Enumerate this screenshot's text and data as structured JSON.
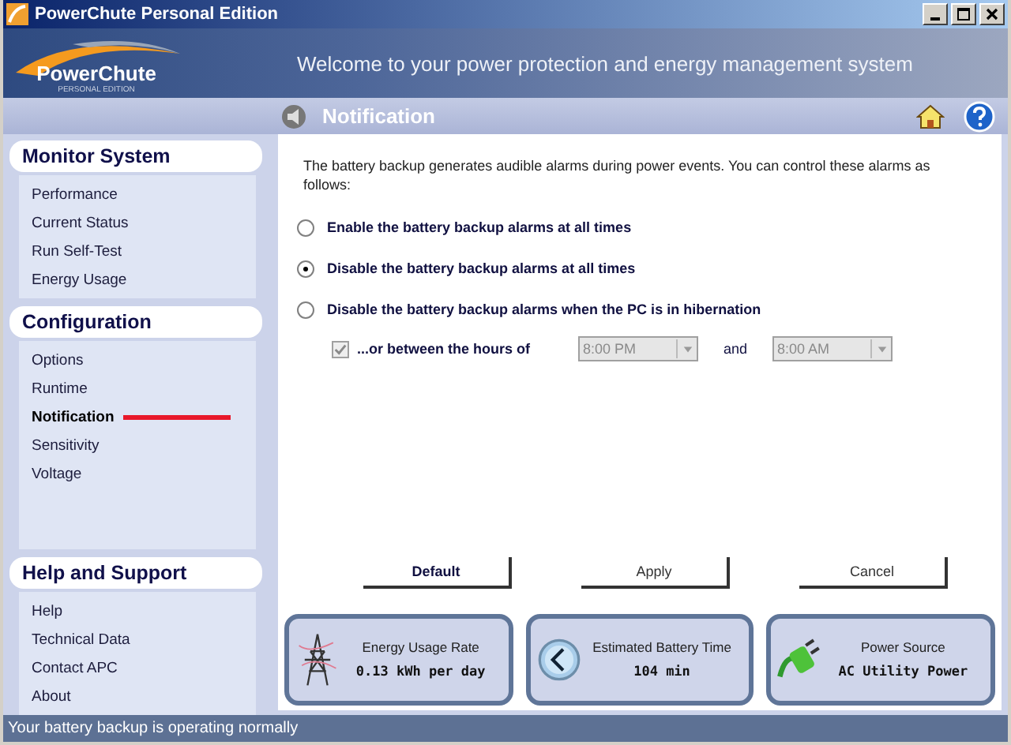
{
  "window": {
    "title": "PowerChute Personal Edition"
  },
  "banner": {
    "logo_name": "PowerChute",
    "logo_sub": "PERSONAL EDITION",
    "welcome": "Welcome to your power protection and energy management system"
  },
  "header": {
    "title": "Notification"
  },
  "sidebar": {
    "sections": [
      {
        "title": "Monitor System",
        "items": [
          {
            "label": "Performance",
            "selected": false
          },
          {
            "label": "Current Status",
            "selected": false
          },
          {
            "label": "Run Self-Test",
            "selected": false
          },
          {
            "label": "Energy Usage",
            "selected": false
          }
        ]
      },
      {
        "title": "Configuration",
        "items": [
          {
            "label": "Options",
            "selected": false
          },
          {
            "label": "Runtime",
            "selected": false
          },
          {
            "label": "Notification",
            "selected": true
          },
          {
            "label": "Sensitivity",
            "selected": false
          },
          {
            "label": "Voltage",
            "selected": false
          }
        ]
      },
      {
        "title": "Help and Support",
        "items": [
          {
            "label": "Help",
            "selected": false
          },
          {
            "label": "Technical Data",
            "selected": false
          },
          {
            "label": "Contact APC",
            "selected": false
          },
          {
            "label": "About",
            "selected": false
          }
        ]
      }
    ]
  },
  "content": {
    "intro": "The battery backup generates audible alarms during power events. You can control these alarms as follows:",
    "options": [
      {
        "label": "Enable the battery backup alarms at all times",
        "selected": false
      },
      {
        "label": "Disable the battery backup alarms at all times",
        "selected": true
      },
      {
        "label": "Disable the battery backup alarms when the PC is in hibernation",
        "selected": false
      }
    ],
    "schedule": {
      "label": "...or between the hours of",
      "checked": true,
      "disabled": true,
      "from": "8:00 PM",
      "and_label": "and",
      "to": "8:00 AM"
    },
    "buttons": [
      {
        "label": "Default",
        "default": true
      },
      {
        "label": "Apply",
        "default": false
      },
      {
        "label": "Cancel",
        "default": false
      }
    ]
  },
  "cards": [
    {
      "kind": "energy",
      "title": "Energy Usage Rate",
      "value": "0.13 kWh per day"
    },
    {
      "kind": "battery",
      "title": "Estimated Battery Time",
      "value": "104 min"
    },
    {
      "kind": "power",
      "title": "Power Source",
      "value": "AC Utility Power"
    }
  ],
  "status_bar": {
    "text": "Your battery backup is operating normally"
  }
}
